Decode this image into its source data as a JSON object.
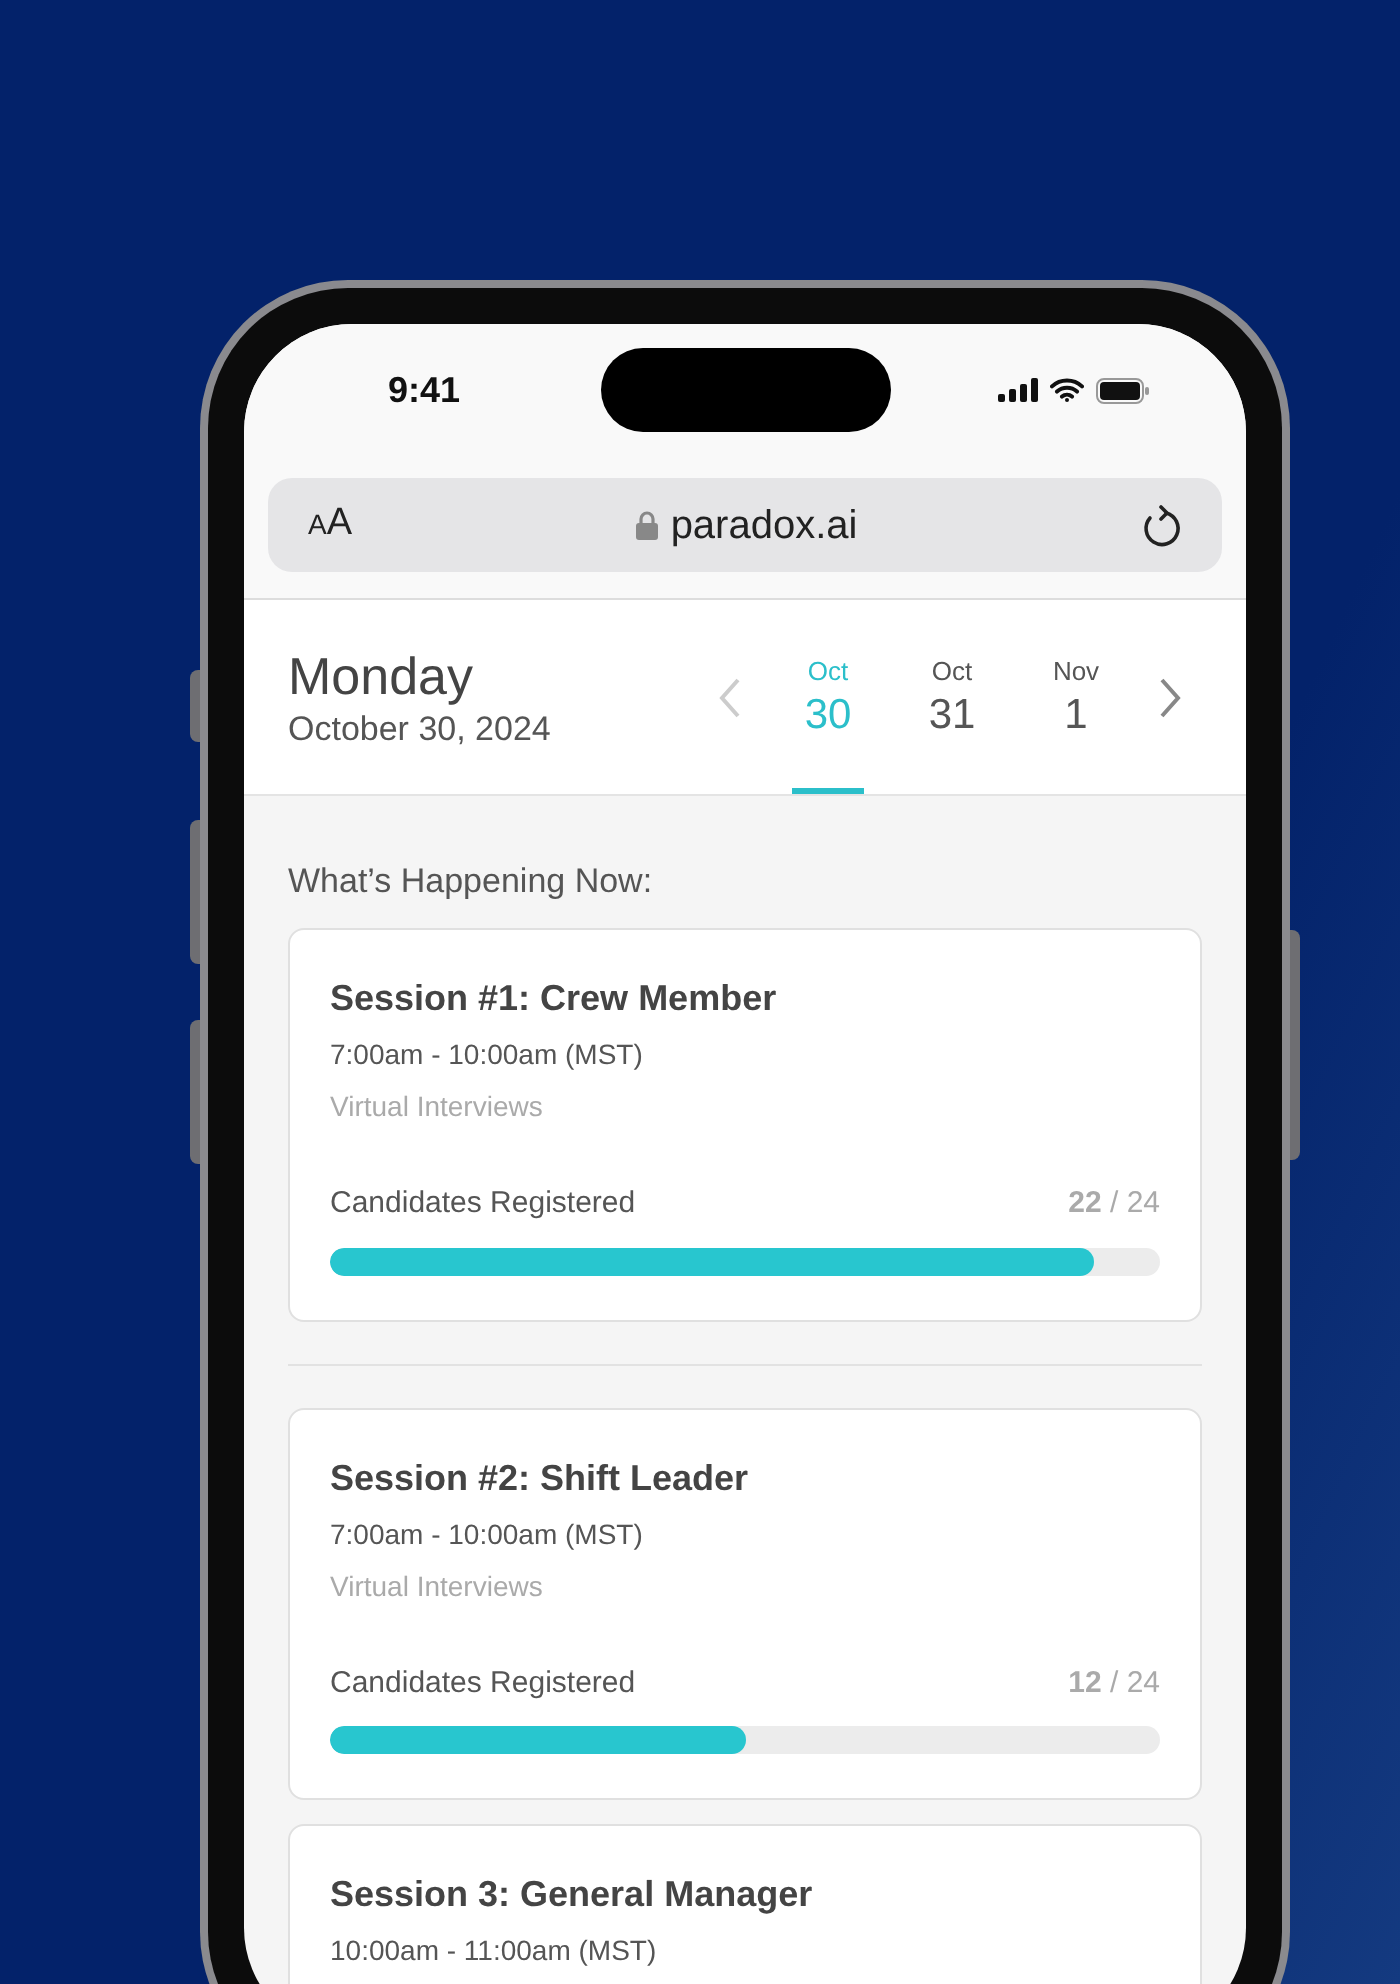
{
  "status_bar": {
    "time": "9:41"
  },
  "browser": {
    "text_size_label": "AA",
    "url": "paradox.ai"
  },
  "date_header": {
    "day": "Monday",
    "date": "October 30, 2024"
  },
  "days": [
    {
      "month": "Oct",
      "day": "30",
      "selected": true
    },
    {
      "month": "Oct",
      "day": "31",
      "selected": false
    },
    {
      "month": "Nov",
      "day": "1",
      "selected": false
    }
  ],
  "section_title": "What’s Happening Now:",
  "sessions": [
    {
      "title": "Session #1: Crew Member",
      "time": "7:00am - 10:00am (MST)",
      "mode": "Virtual Interviews",
      "progress_label": "Candidates Registered",
      "count": "**22** / 24",
      "level": 0.92
    },
    {
      "title": "Session #2: Shift Leader",
      "time": "7:00am - 10:00am (MST)",
      "mode": "Virtual Interviews",
      "progress_label": "Candidates Registered",
      "count": "**12** / 24",
      "level": 0.5
    },
    {
      "title": "Session 3: General Manager",
      "time": "10:00am - 11:00am (MST)"
    }
  ]
}
